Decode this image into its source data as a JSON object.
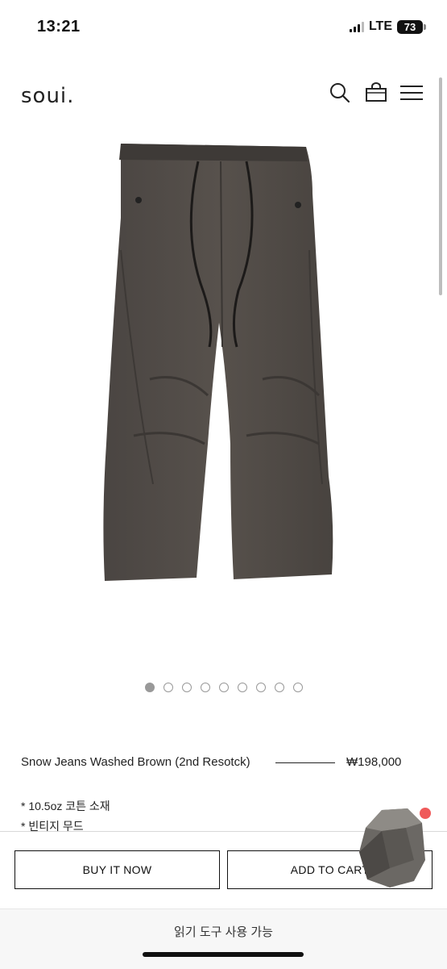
{
  "status_bar": {
    "time": "13:21",
    "network": "LTE",
    "battery": "73"
  },
  "header": {
    "logo": "soui."
  },
  "product": {
    "name": "Snow Jeans Washed Brown (2nd Resotck)",
    "price": "₩198,000",
    "description": [
      "* 10.5oz 코튼 소재",
      "* 빈티지 무드"
    ],
    "image_count": 9,
    "active_image_index": 0
  },
  "buttons": {
    "buy": "BUY IT NOW",
    "cart": "ADD TO CART"
  },
  "reader_bar": {
    "label": "읽기 도구 사용 가능"
  },
  "colors": {
    "pants": "#4f4a46",
    "accent_badge": "#ef5a5a"
  }
}
